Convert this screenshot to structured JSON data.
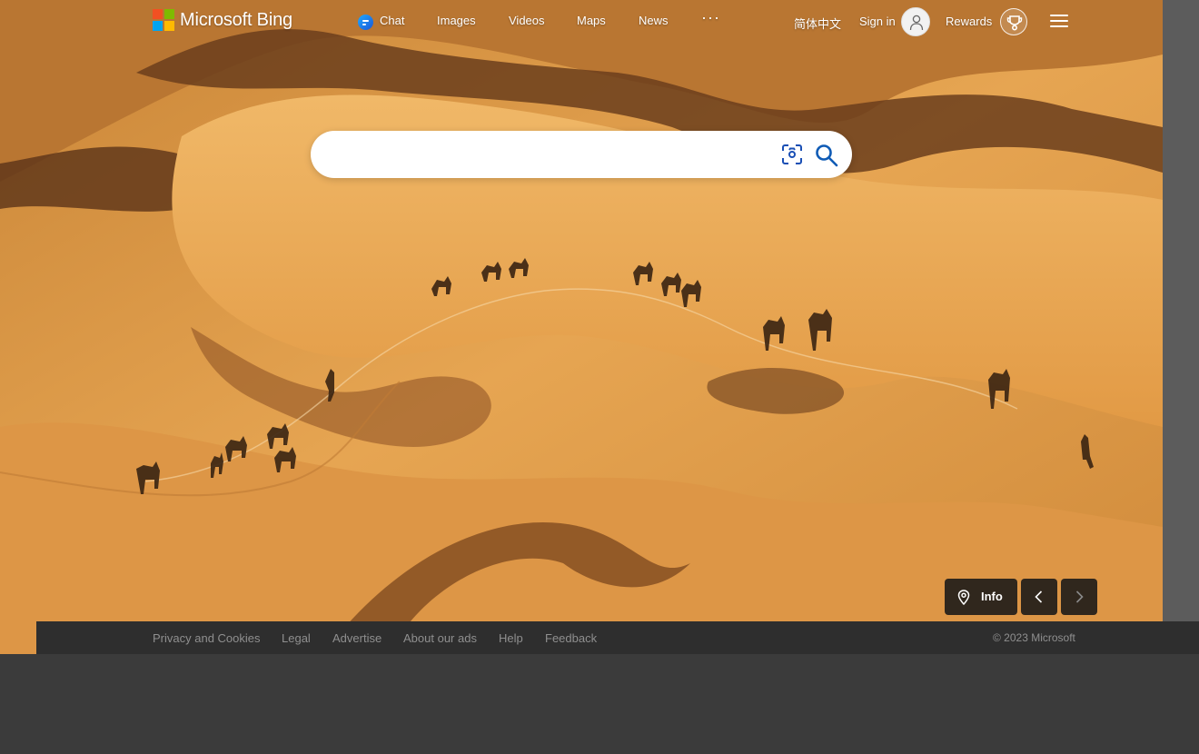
{
  "header": {
    "brand": "Microsoft Bing",
    "nav": [
      {
        "label": "Chat",
        "icon": "chat-icon"
      },
      {
        "label": "Images"
      },
      {
        "label": "Videos"
      },
      {
        "label": "Maps"
      },
      {
        "label": "News"
      },
      {
        "label": "···"
      }
    ],
    "language": "简体中文",
    "sign_in": "Sign in",
    "rewards": "Rewards"
  },
  "search": {
    "value": "",
    "placeholder": ""
  },
  "image_controls": {
    "info_label": "Info"
  },
  "footer": {
    "links": [
      "Privacy and Cookies",
      "Legal",
      "Advertise",
      "About our ads",
      "Help",
      "Feedback"
    ],
    "copyright": "© 2023 Microsoft"
  },
  "colors": {
    "accent": "#0078d4",
    "footer_bg": "#2e2e2e",
    "page_bg": "#3b3b3b"
  }
}
